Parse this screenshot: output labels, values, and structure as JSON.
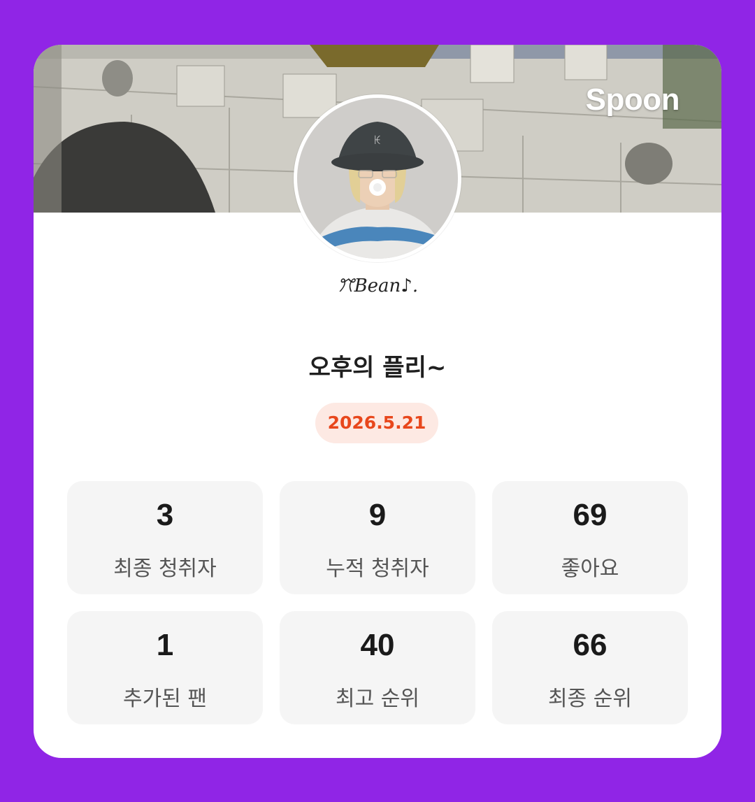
{
  "app": {
    "brand": "Spoon",
    "accent_color": "#9025e6"
  },
  "profile": {
    "signature": "ꔫBean♪.",
    "live_title": "오후의 플리~",
    "date": "2026.5.21"
  },
  "stats": [
    {
      "value": "3",
      "label": "최종 청취자"
    },
    {
      "value": "9",
      "label": "누적 청취자"
    },
    {
      "value": "69",
      "label": "좋아요"
    },
    {
      "value": "1",
      "label": "추가된 팬"
    },
    {
      "value": "40",
      "label": "최고 순위"
    },
    {
      "value": "66",
      "label": "최종 순위"
    }
  ]
}
